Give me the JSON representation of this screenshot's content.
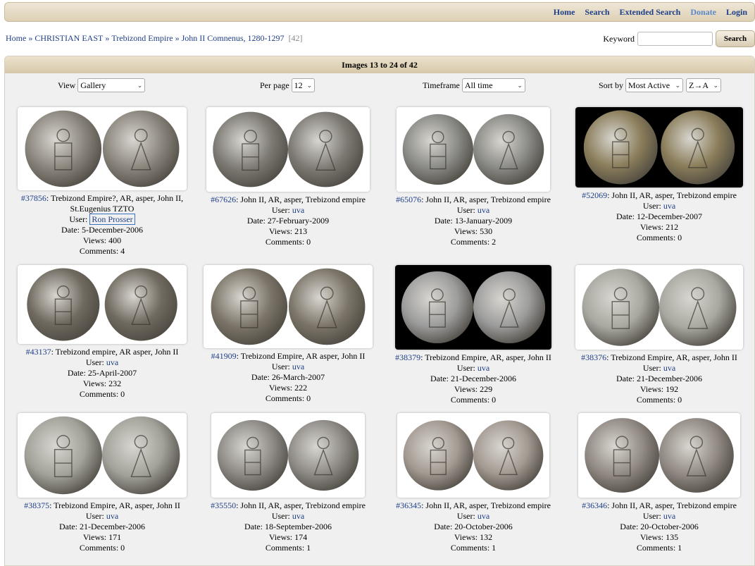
{
  "nav": {
    "home": "Home",
    "search": "Search",
    "extended_search": "Extended Search",
    "donate": "Donate",
    "login": "Login"
  },
  "breadcrumb": {
    "items": [
      "Home",
      "CHRISTIAN EAST",
      "Trebizond Empire",
      "John II Comnenus, 1280-1297"
    ],
    "separator": "»",
    "count": "[42]"
  },
  "keyword_search": {
    "label": "Keyword",
    "value": "",
    "button": "Search"
  },
  "panel": {
    "title": "Images 13 to 24 of 42"
  },
  "controls": {
    "view_label": "View",
    "view_value": "Gallery",
    "per_page_label": "Per page",
    "per_page_value": "12",
    "timeframe_label": "Timeframe",
    "timeframe_value": "All time",
    "sort_label": "Sort by",
    "sort_value": "Most Active",
    "order_value": "Z→A"
  },
  "labels": {
    "user": "User:",
    "date": "Date:",
    "views": "Views:",
    "comments": "Comments:"
  },
  "colors": {
    "link": "#1f3f87",
    "header_bar": "#ddd0b6",
    "panel_bg": "#f0f0f0"
  },
  "items": [
    {
      "id": "#37856",
      "title": "Trebizond Empire?, AR, asper, John II, St.Eugenius TZTO",
      "user": "Ron Prosser",
      "date": "5-December-2006",
      "views": "400",
      "comments": "4"
    },
    {
      "id": "#67626",
      "title": "John II, AR, asper, Trebizond empire",
      "user": "uva",
      "date": "27-February-2009",
      "views": "213",
      "comments": "0"
    },
    {
      "id": "#65076",
      "title": "John II, AR, asper, Trebizond empire",
      "user": "uva",
      "date": "13-January-2009",
      "views": "530",
      "comments": "2"
    },
    {
      "id": "#52069",
      "title": "John II, AR, asper, Trebizond empire",
      "user": "uva",
      "date": "12-December-2007",
      "views": "212",
      "comments": "0"
    },
    {
      "id": "#43137",
      "title": "Trebizond empire, AR asper, John II",
      "user": "uva",
      "date": "25-April-2007",
      "views": "232",
      "comments": "0"
    },
    {
      "id": "#41909",
      "title": "Trebizond Empire, AR asper, John II",
      "user": "uva",
      "date": "26-March-2007",
      "views": "222",
      "comments": "0"
    },
    {
      "id": "#38379",
      "title": "Trebizond Empire, AR, asper, John II",
      "user": "uva",
      "date": "21-December-2006",
      "views": "229",
      "comments": "0"
    },
    {
      "id": "#38376",
      "title": "Trebizond Empire, AR, asper, John II",
      "user": "uva",
      "date": "21-December-2006",
      "views": "192",
      "comments": "0"
    },
    {
      "id": "#38375",
      "title": "Trebizond Empire, AR, asper, John II",
      "user": "uva",
      "date": "21-December-2006",
      "views": "171",
      "comments": "0"
    },
    {
      "id": "#35550",
      "title": "John II, AR, asper, Trebizond empire",
      "user": "uva",
      "date": "18-September-2006",
      "views": "174",
      "comments": "1"
    },
    {
      "id": "#36345",
      "title": "John II, AR, asper, Trebizond empire",
      "user": "uva",
      "date": "20-October-2006",
      "views": "132",
      "comments": "1"
    },
    {
      "id": "#36346",
      "title": "John II, AR, asper, Trebizond empire",
      "user": "uva",
      "date": "20-October-2006",
      "views": "135",
      "comments": "1"
    }
  ]
}
